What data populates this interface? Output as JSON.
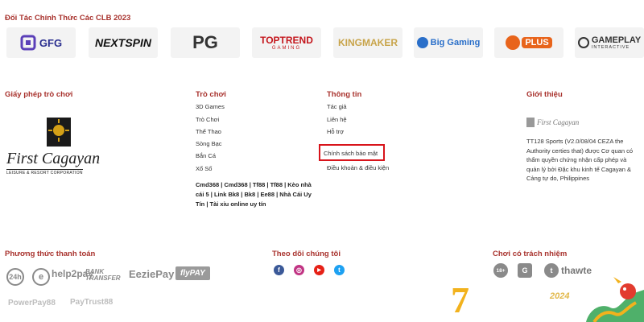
{
  "partners": {
    "title": "Đối Tác Chính Thức Các CLB 2023",
    "items": [
      {
        "label": "GFG",
        "color": "#2b2f8f"
      },
      {
        "label": "NEXTSPIN",
        "color": "#111111"
      },
      {
        "label": "PG",
        "color": "#333333"
      },
      {
        "label": "TOPTREND",
        "sub": "GAMING",
        "color": "#c4161c"
      },
      {
        "label": "KINGMAKER",
        "color": "#c8a44a"
      },
      {
        "label": "Big Gaming",
        "color": "#2a6fc9"
      },
      {
        "label": "PLUS",
        "color": "#e8641b"
      },
      {
        "label": "GAMEPLAY",
        "sub": "INTERACTIVE",
        "color": "#333333"
      }
    ]
  },
  "license": {
    "title": "Giấy phép trò chơi",
    "logo_text": "First Cagayan",
    "logo_sub": "LEISURE & RESORT CORPORATION"
  },
  "games": {
    "title": "Trò chơi",
    "items": [
      "3D Games",
      "Trò Chơi",
      "Thể Thao",
      "Sòng Bạc",
      "Bắn Cá",
      "Xổ Số"
    ],
    "bold_links": "Cmd368 | Cmd368 | Tf88 | Tf88 | Kèo nhà cái 5 | Link Bk8 | Bk8 | Ee88 | Nhà Cái Uy Tín | Tài xỉu online uy tín"
  },
  "info": {
    "title": "Thông tin",
    "items": [
      "Tác giả",
      "Liên hệ",
      "Hỗ trợ",
      "Chính sách bảo mật",
      "Điều khoản & điều kiện"
    ]
  },
  "about": {
    "title": "Giới thiệu",
    "logo_text": "First Cagayan",
    "text": "TT128 Sports (V2.0/08/04 CEZA the Authority certies that) được Cơ quan có thẩm quyền chứng nhận cấp phép và quản lý bởi Đặc khu kinh tế Cagayan & Cảng tự do, Philippines"
  },
  "payment": {
    "title": "Phương thức thanh toán",
    "items": [
      "24h",
      "e",
      "help2pay",
      "BANK TRANSFER",
      "EeziePay",
      "flyPAY",
      "PowerPay88",
      "PayTrust88"
    ]
  },
  "follow": {
    "title": "Theo dõi chúng tôi",
    "items": [
      {
        "label": "f",
        "icon": "facebook-icon",
        "color": "#3b5998"
      },
      {
        "label": "◎",
        "icon": "instagram-icon",
        "color": "#c13584"
      },
      {
        "label": "▶",
        "icon": "youtube-icon",
        "color": "#e62117"
      },
      {
        "label": "t",
        "icon": "twitter-icon",
        "color": "#1da1f2"
      }
    ]
  },
  "responsible": {
    "title": "Chơi có trách nhiệm",
    "items": [
      "18+",
      "G",
      "t"
    ],
    "thawte": "thawte"
  },
  "promo": {
    "year": "2024",
    "number": "7"
  }
}
